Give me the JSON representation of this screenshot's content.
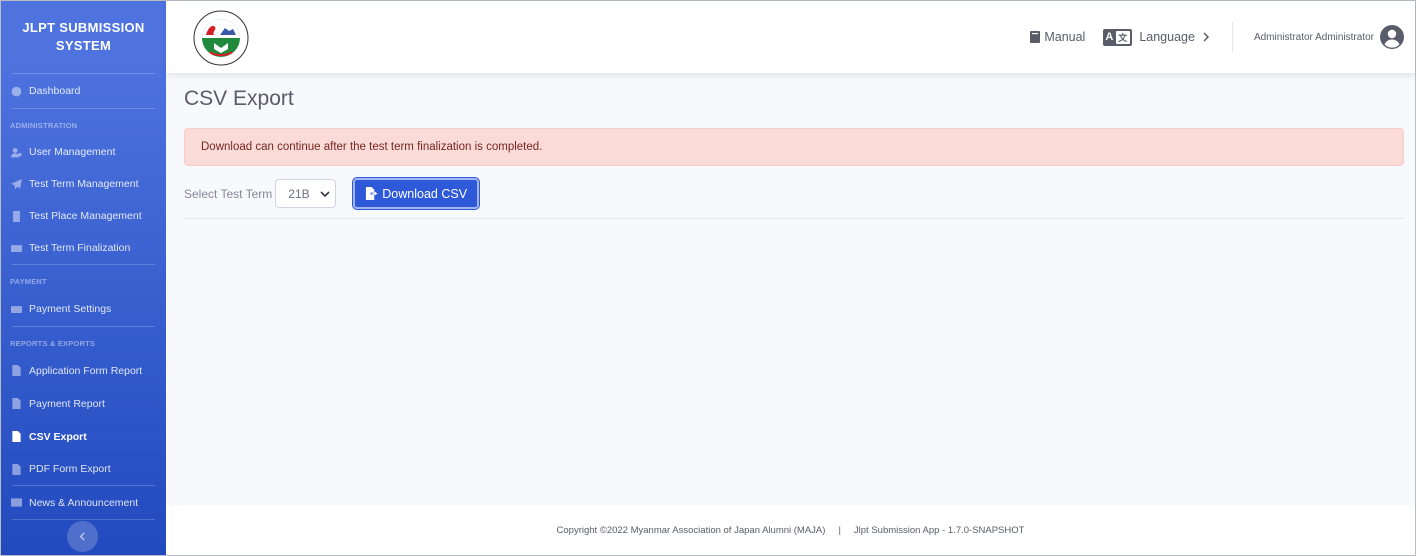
{
  "brand": {
    "line1": "JLPT SUBMISSION",
    "line2": "SYSTEM"
  },
  "sidebar": {
    "dashboard": "Dashboard",
    "admin_heading": "ADMINISTRATION",
    "user_management": "User Management",
    "test_term_management": "Test Term Management",
    "test_place_management": "Test Place Management",
    "test_term_finalization": "Test Term Finalization",
    "payment_heading": "PAYMENT",
    "payment_settings": "Payment Settings",
    "reports_heading": "REPORTS & EXPORTS",
    "application_form_report": "Application Form Report",
    "payment_report": "Payment Report",
    "csv_export": "CSV Export",
    "pdf_form_export": "PDF Form Export",
    "news_announcement": "News & Announcement"
  },
  "topbar": {
    "manual": "Manual",
    "language": "Language",
    "lang_icon_a": "A",
    "lang_icon_b": "文",
    "user_name": "Administrator Administrator"
  },
  "main": {
    "title": "CSV Export",
    "alert": "Download can continue after the test term finalization is completed.",
    "select_label": "Select Test Term",
    "select_value": "21B",
    "download_button": "Download CSV"
  },
  "footer": {
    "copyright": "Copyright ©2022 Myanmar Association of Japan Alumni (MAJA)",
    "separator": "|",
    "version": "Jlpt Submission App - 1.7.0-SNAPSHOT"
  },
  "colors": {
    "sidebar_top": "#4e73df",
    "sidebar_bottom": "#224abe",
    "primary_button": "#2e59d9",
    "alert_bg": "#fadbd8",
    "alert_text": "#78261f"
  },
  "icons": {
    "dashboard": "gauge-icon",
    "user_management": "user-gear-icon",
    "test_term_management": "paper-plane-icon",
    "test_place_management": "building-icon",
    "test_term_finalization": "id-card-icon",
    "payment_settings": "credit-card-icon",
    "application_form_report": "file-icon",
    "payment_report": "file-icon",
    "csv_export": "file-icon",
    "pdf_form_export": "file-icon",
    "news_announcement": "newspaper-icon",
    "manual": "book-icon",
    "language": "language-icon",
    "user": "user-circle-icon",
    "download": "file-export-icon",
    "toggle": "chevron-left-icon"
  }
}
